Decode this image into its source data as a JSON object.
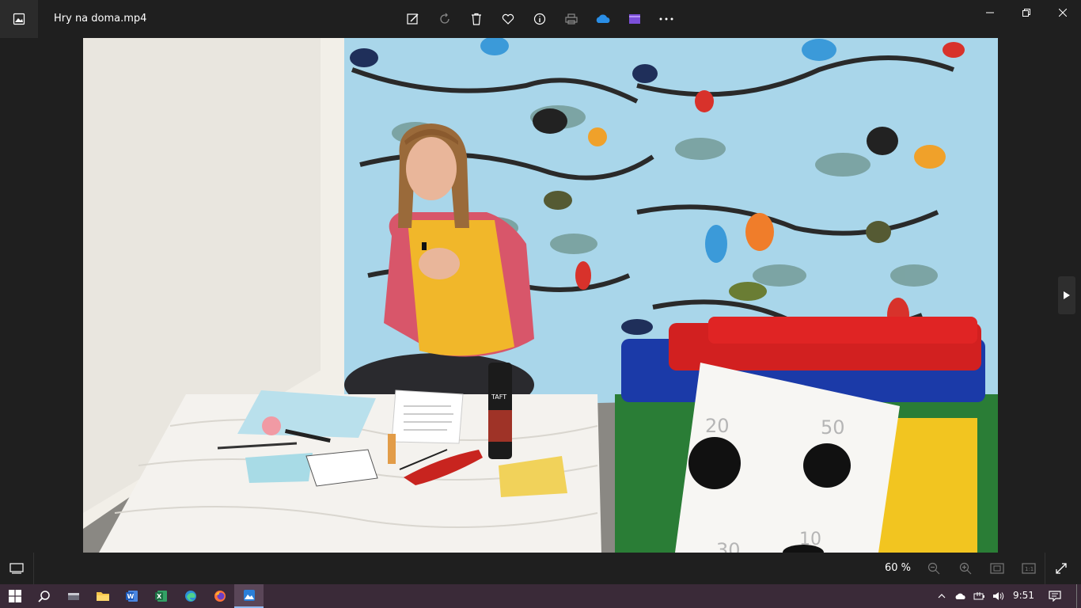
{
  "window": {
    "title": "Hry na doma.mp4"
  },
  "toolbar": {
    "icons": [
      "edit-image-icon",
      "rotate-icon",
      "delete-icon",
      "favorite-icon",
      "info-icon",
      "print-icon",
      "onedrive-icon",
      "video-editor-icon",
      "more-icon"
    ]
  },
  "window_controls": [
    "minimize-icon",
    "restore-icon",
    "close-icon"
  ],
  "viewer": {
    "content": "video-frame",
    "target_card": {
      "labels": [
        "20",
        "50",
        "30",
        "10"
      ]
    },
    "spray_label": "TAFT"
  },
  "bottom_bar": {
    "zoom_value": "60 %"
  },
  "taskbar": {
    "apps": [
      "start-icon",
      "search-icon",
      "video-app-icon",
      "file-explorer-icon",
      "word-icon",
      "excel-icon",
      "edge-icon",
      "firefox-icon",
      "photos-icon"
    ],
    "time": "9:51"
  },
  "colors": {
    "chrome": "#1f1f1f",
    "taskbar": "#3a2a38",
    "accent": "#8fb9f0"
  }
}
